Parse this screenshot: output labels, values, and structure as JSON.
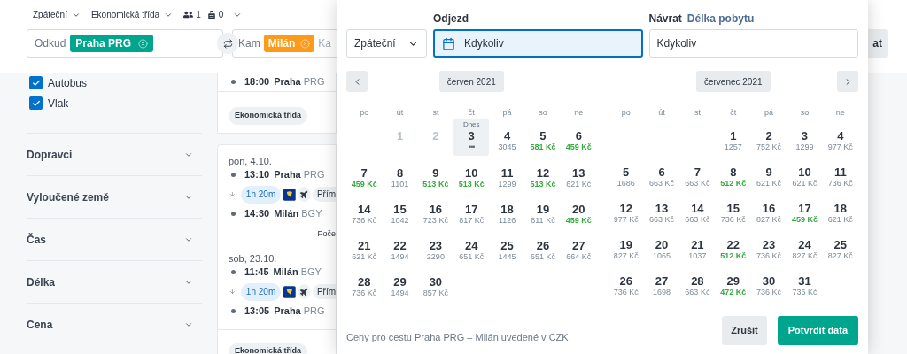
{
  "search_bar": {
    "trip_type": "Zpáteční",
    "cabin": "Ekonomická třída",
    "passengers": "1",
    "bags": "0",
    "origin": {
      "label": "Odkud",
      "chip": "Praha PRG"
    },
    "destination": {
      "label": "Kam",
      "chip": "Milán",
      "placeholder": "Ka"
    },
    "search_button": "at"
  },
  "sidebar": {
    "transport": [
      {
        "label": "Autobus",
        "checked": true
      },
      {
        "label": "Vlak",
        "checked": true
      }
    ],
    "filters": [
      "Dopravci",
      "Vyloučené země",
      "Čas",
      "Délka",
      "Cena"
    ]
  },
  "results": [
    {
      "stops": [
        {
          "time": "18:00",
          "city": "Praha",
          "code": "PRG"
        }
      ],
      "cabin": "Ekonomická třída"
    },
    {
      "legs": [
        {
          "date": "pon, 4.10.",
          "departure": {
            "time": "13:10",
            "city": "Praha",
            "code": "PRG"
          },
          "duration": "1h 20m",
          "tag": "Přím",
          "arrival": {
            "time": "14:30",
            "city": "Milán",
            "code": "BGY"
          }
        },
        {
          "date": "sob, 23.10.",
          "departure": {
            "time": "11:45",
            "city": "Milán",
            "code": "BGY"
          },
          "duration": "1h 20m",
          "tag": "Přím",
          "arrival": {
            "time": "13:05",
            "city": "Praha",
            "code": "PRG"
          }
        }
      ],
      "note": "Poče",
      "cabin": "Ekonomická třída"
    }
  ],
  "date_picker": {
    "trip_select": "Zpáteční",
    "departure": {
      "label": "Odjezd",
      "value": "Kdykoliv",
      "active": true
    },
    "return": {
      "label": "Návrat",
      "link": "Délka pobytu",
      "value": "Kdykoliv",
      "active": false
    },
    "months": [
      {
        "title": "červen 2021",
        "weekdays": [
          "po",
          "út",
          "st",
          "čt",
          "pá",
          "so",
          "ne"
        ],
        "weeks": [
          [
            {
              "kind": "blank"
            },
            {
              "kind": "past",
              "day": "1"
            },
            {
              "kind": "past",
              "day": "2"
            },
            {
              "kind": "today",
              "label": "Dnes",
              "day": "3",
              "indicator": "•••"
            },
            {
              "kind": "day",
              "day": "4",
              "price": "3045",
              "cheap": false
            },
            {
              "kind": "day",
              "day": "5",
              "price": "581 Kč",
              "cheap": true
            },
            {
              "kind": "day",
              "day": "6",
              "price": "459 Kč",
              "cheap": true
            }
          ],
          [
            {
              "kind": "day",
              "day": "7",
              "price": "459 Kč",
              "cheap": true
            },
            {
              "kind": "day",
              "day": "8",
              "price": "1101",
              "cheap": false
            },
            {
              "kind": "day",
              "day": "9",
              "price": "513 Kč",
              "cheap": true
            },
            {
              "kind": "day",
              "day": "10",
              "price": "513 Kč",
              "cheap": true
            },
            {
              "kind": "day",
              "day": "11",
              "price": "1299",
              "cheap": false
            },
            {
              "kind": "day",
              "day": "12",
              "price": "513 Kč",
              "cheap": true
            },
            {
              "kind": "day",
              "day": "13",
              "price": "621 Kč",
              "cheap": false
            }
          ],
          [
            {
              "kind": "day",
              "day": "14",
              "price": "736 Kč",
              "cheap": false
            },
            {
              "kind": "day",
              "day": "15",
              "price": "1042",
              "cheap": false
            },
            {
              "kind": "day",
              "day": "16",
              "price": "723 Kč",
              "cheap": false
            },
            {
              "kind": "day",
              "day": "17",
              "price": "817 Kč",
              "cheap": false
            },
            {
              "kind": "day",
              "day": "18",
              "price": "1126",
              "cheap": false
            },
            {
              "kind": "day",
              "day": "19",
              "price": "811 Kč",
              "cheap": false
            },
            {
              "kind": "day",
              "day": "20",
              "price": "459 Kč",
              "cheap": true
            }
          ],
          [
            {
              "kind": "day",
              "day": "21",
              "price": "621 Kč",
              "cheap": false
            },
            {
              "kind": "day",
              "day": "22",
              "price": "1494",
              "cheap": false
            },
            {
              "kind": "day",
              "day": "23",
              "price": "2290",
              "cheap": false
            },
            {
              "kind": "day",
              "day": "24",
              "price": "651 Kč",
              "cheap": false
            },
            {
              "kind": "day",
              "day": "25",
              "price": "1445",
              "cheap": false
            },
            {
              "kind": "day",
              "day": "26",
              "price": "651 Kč",
              "cheap": false
            },
            {
              "kind": "day",
              "day": "27",
              "price": "664 Kč",
              "cheap": false
            }
          ],
          [
            {
              "kind": "day",
              "day": "28",
              "price": "736 Kč",
              "cheap": false
            },
            {
              "kind": "day",
              "day": "29",
              "price": "1494",
              "cheap": false
            },
            {
              "kind": "day",
              "day": "30",
              "price": "857 Kč",
              "cheap": false
            }
          ]
        ]
      },
      {
        "title": "červenec 2021",
        "weekdays": [
          "po",
          "út",
          "st",
          "čt",
          "pá",
          "so",
          "ne"
        ],
        "weeks": [
          [
            {
              "kind": "blank"
            },
            {
              "kind": "blank"
            },
            {
              "kind": "blank"
            },
            {
              "kind": "day",
              "day": "1",
              "price": "1257",
              "cheap": false
            },
            {
              "kind": "day",
              "day": "2",
              "price": "752 Kč",
              "cheap": false
            },
            {
              "kind": "day",
              "day": "3",
              "price": "1299",
              "cheap": false
            },
            {
              "kind": "day",
              "day": "4",
              "price": "977 Kč",
              "cheap": false
            }
          ],
          [
            {
              "kind": "day",
              "day": "5",
              "price": "1686",
              "cheap": false
            },
            {
              "kind": "day",
              "day": "6",
              "price": "663 Kč",
              "cheap": false
            },
            {
              "kind": "day",
              "day": "7",
              "price": "663 Kč",
              "cheap": false
            },
            {
              "kind": "day",
              "day": "8",
              "price": "512 Kč",
              "cheap": true
            },
            {
              "kind": "day",
              "day": "9",
              "price": "621 Kč",
              "cheap": false
            },
            {
              "kind": "day",
              "day": "10",
              "price": "621 Kč",
              "cheap": false
            },
            {
              "kind": "day",
              "day": "11",
              "price": "736 Kč",
              "cheap": false
            }
          ],
          [
            {
              "kind": "day",
              "day": "12",
              "price": "977 Kč",
              "cheap": false
            },
            {
              "kind": "day",
              "day": "13",
              "price": "663 Kč",
              "cheap": false
            },
            {
              "kind": "day",
              "day": "14",
              "price": "663 Kč",
              "cheap": false
            },
            {
              "kind": "day",
              "day": "15",
              "price": "736 Kč",
              "cheap": false
            },
            {
              "kind": "day",
              "day": "16",
              "price": "827 Kč",
              "cheap": false
            },
            {
              "kind": "day",
              "day": "17",
              "price": "459 Kč",
              "cheap": true
            },
            {
              "kind": "day",
              "day": "18",
              "price": "621 Kč",
              "cheap": false
            }
          ],
          [
            {
              "kind": "day",
              "day": "19",
              "price": "827 Kč",
              "cheap": false
            },
            {
              "kind": "day",
              "day": "20",
              "price": "1065",
              "cheap": false
            },
            {
              "kind": "day",
              "day": "21",
              "price": "1037",
              "cheap": false
            },
            {
              "kind": "day",
              "day": "22",
              "price": "512 Kč",
              "cheap": true
            },
            {
              "kind": "day",
              "day": "23",
              "price": "736 Kč",
              "cheap": false
            },
            {
              "kind": "day",
              "day": "24",
              "price": "827 Kč",
              "cheap": false
            },
            {
              "kind": "day",
              "day": "25",
              "price": "827 Kč",
              "cheap": false
            }
          ],
          [
            {
              "kind": "day",
              "day": "26",
              "price": "736 Kč",
              "cheap": false
            },
            {
              "kind": "day",
              "day": "27",
              "price": "1698",
              "cheap": false
            },
            {
              "kind": "day",
              "day": "28",
              "price": "663 Kč",
              "cheap": false
            },
            {
              "kind": "day",
              "day": "29",
              "price": "472 Kč",
              "cheap": true
            },
            {
              "kind": "day",
              "day": "30",
              "price": "736 Kč",
              "cheap": false
            },
            {
              "kind": "day",
              "day": "31",
              "price": "736 Kč",
              "cheap": false
            }
          ]
        ]
      }
    ],
    "note": "Ceny pro cestu Praha PRG – Milán uvedené v CZK",
    "buttons": {
      "cancel": "Zrušit",
      "confirm": "Potvrdit data"
    }
  }
}
